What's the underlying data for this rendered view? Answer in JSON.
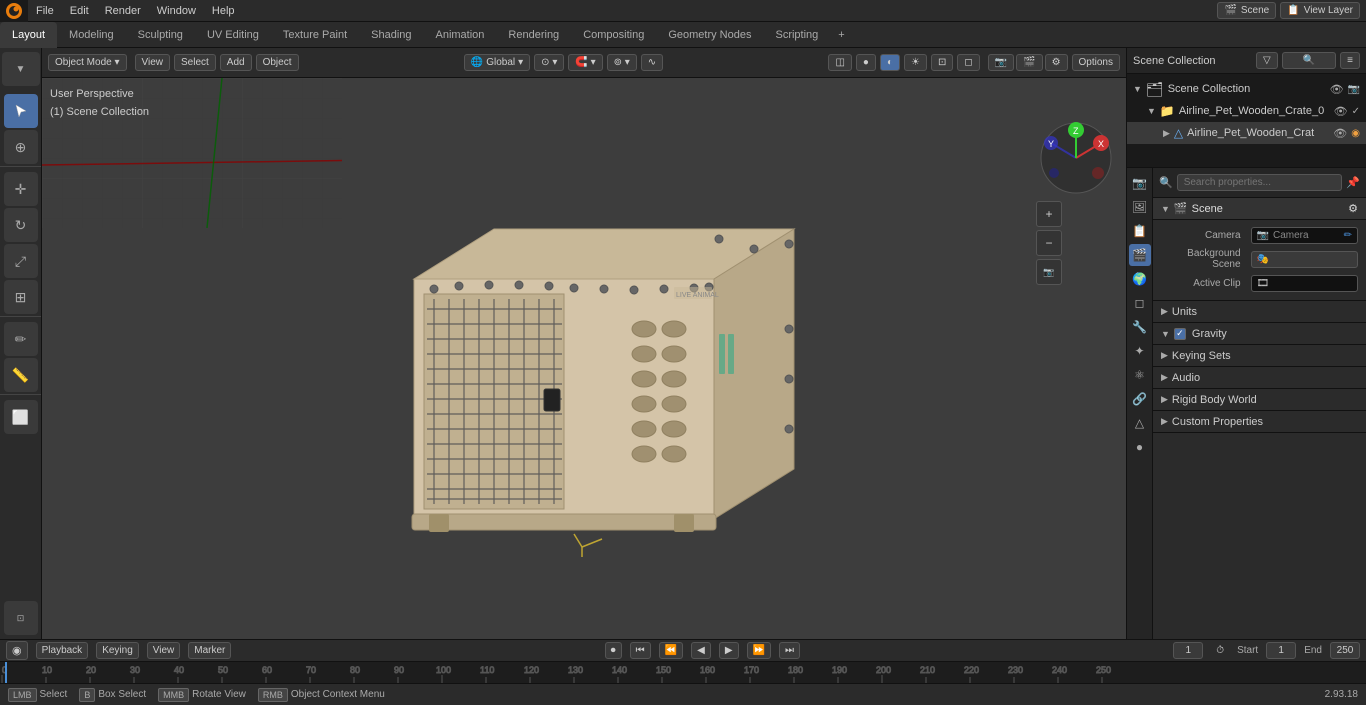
{
  "app": {
    "title": "Blender",
    "version": "2.93.18"
  },
  "top_menu": {
    "logo": "🔵",
    "items": [
      "File",
      "Edit",
      "Render",
      "Window",
      "Help"
    ]
  },
  "workspace_tabs": {
    "tabs": [
      "Layout",
      "Modeling",
      "Sculpting",
      "UV Editing",
      "Texture Paint",
      "Shading",
      "Animation",
      "Rendering",
      "Compositing",
      "Geometry Nodes",
      "Scripting"
    ],
    "active": "Layout"
  },
  "viewport": {
    "mode": "Object Mode",
    "view": "View",
    "select": "Select",
    "add": "Add",
    "object": "Object",
    "transform": "Global",
    "scene_info": {
      "line1": "User Perspective",
      "line2": "(1) Scene Collection"
    }
  },
  "outliner": {
    "title": "Scene Collection",
    "items": [
      {
        "name": "Airline_Pet_Wooden_Crate_0",
        "type": "collection",
        "indent": 0,
        "expanded": true
      },
      {
        "name": "Airline_Pet_Wooden_Crat",
        "type": "mesh",
        "indent": 1,
        "expanded": false
      }
    ]
  },
  "properties_panel": {
    "active_tab": "scene",
    "tabs": [
      "render",
      "output",
      "view_layer",
      "scene",
      "world",
      "object",
      "modifier",
      "particles",
      "physics",
      "constraints",
      "data",
      "material"
    ],
    "scene_section": {
      "title": "Scene",
      "camera_label": "Camera",
      "camera_value": "",
      "background_scene_label": "Background Scene",
      "active_clip_label": "Active Clip",
      "active_clip_value": ""
    },
    "units": {
      "label": "Units",
      "collapsed": true
    },
    "gravity": {
      "label": "Gravity",
      "checked": true
    },
    "keying_sets": {
      "label": "Keying Sets",
      "collapsed": true
    },
    "audio": {
      "label": "Audio",
      "collapsed": true
    },
    "rigid_body_world": {
      "label": "Rigid Body World",
      "collapsed": true
    },
    "custom_properties": {
      "label": "Custom Properties",
      "collapsed": true
    }
  },
  "timeline": {
    "playback_label": "Playback",
    "keying_label": "Keying",
    "view_label": "View",
    "marker_label": "Marker",
    "current_frame": "1",
    "start_label": "Start",
    "start_value": "1",
    "end_label": "End",
    "end_value": "250",
    "ruler_marks": [
      "0",
      "10",
      "20",
      "30",
      "40",
      "50",
      "60",
      "70",
      "80",
      "90",
      "100",
      "110",
      "120",
      "130",
      "140",
      "150",
      "160",
      "170",
      "180",
      "190",
      "200",
      "210",
      "220",
      "230",
      "240",
      "250"
    ]
  },
  "status_bar": {
    "select": "Select",
    "box_select": "Box Select",
    "rotate": "Rotate View",
    "context_menu": "Object Context Menu",
    "version": "2.93.18"
  },
  "options_button": "Options",
  "view_layer": "View Layer"
}
